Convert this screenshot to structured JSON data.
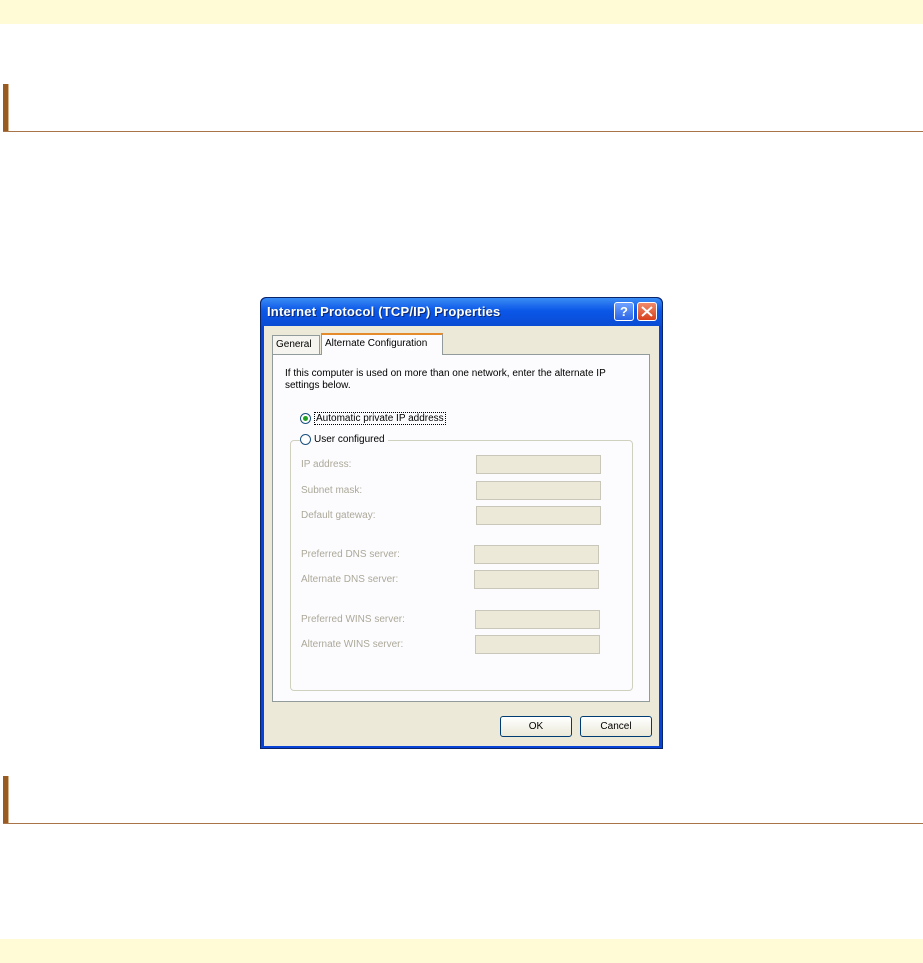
{
  "dialog": {
    "title": "Internet Protocol (TCP/IP) Properties",
    "help_label": "?",
    "tabs": [
      "General",
      "Alternate Configuration"
    ],
    "description": "If this computer is used on more than one network, enter the alternate IP settings below.",
    "options": {
      "automatic": "Automatic private IP address",
      "user": "User configured"
    },
    "fields": {
      "ip_address": "IP address:",
      "subnet_mask": "Subnet mask:",
      "default_gateway": "Default gateway:",
      "preferred_dns": "Preferred DNS server:",
      "alternate_dns": "Alternate DNS server:",
      "preferred_wins": "Preferred WINS server:",
      "alternate_wins": "Alternate WINS server:"
    },
    "buttons": {
      "ok": "OK",
      "cancel": "Cancel"
    }
  },
  "colors": {
    "title_bar": "#0b57e8",
    "client": "#ece9d8",
    "band": "#fffbd6",
    "section_bar": "#9a5b23"
  }
}
